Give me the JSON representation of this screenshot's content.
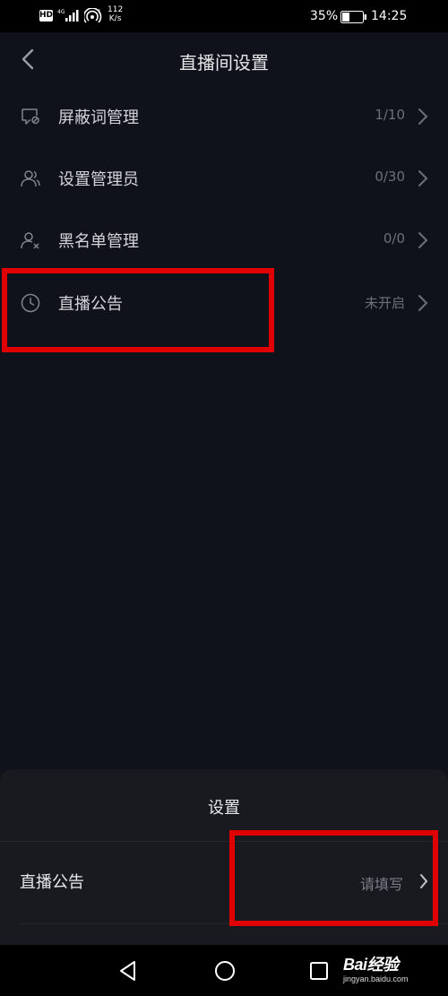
{
  "status_bar": {
    "hd": "HD",
    "net_type": "4G",
    "speed_value": "112",
    "speed_unit": "K/s",
    "battery": "35%",
    "time": "14:25"
  },
  "header": {
    "title": "直播间设置"
  },
  "settings": [
    {
      "icon": "comment-block-icon",
      "label": "屏蔽词管理",
      "value": "1/10"
    },
    {
      "icon": "users-icon",
      "label": "设置管理员",
      "value": "0/30"
    },
    {
      "icon": "user-block-icon",
      "label": "黑名单管理",
      "value": "0/0"
    },
    {
      "icon": "clock-icon",
      "label": "直播公告",
      "value": "未开启"
    }
  ],
  "sheet": {
    "title": "设置",
    "row_label": "直播公告",
    "row_value": "请填写"
  },
  "watermark": {
    "logo": "Bai经验",
    "url": "jingyan.baidu.com"
  },
  "colors": {
    "background": "#0f121a",
    "sheet": "#181a20",
    "highlight": "#e00000"
  }
}
